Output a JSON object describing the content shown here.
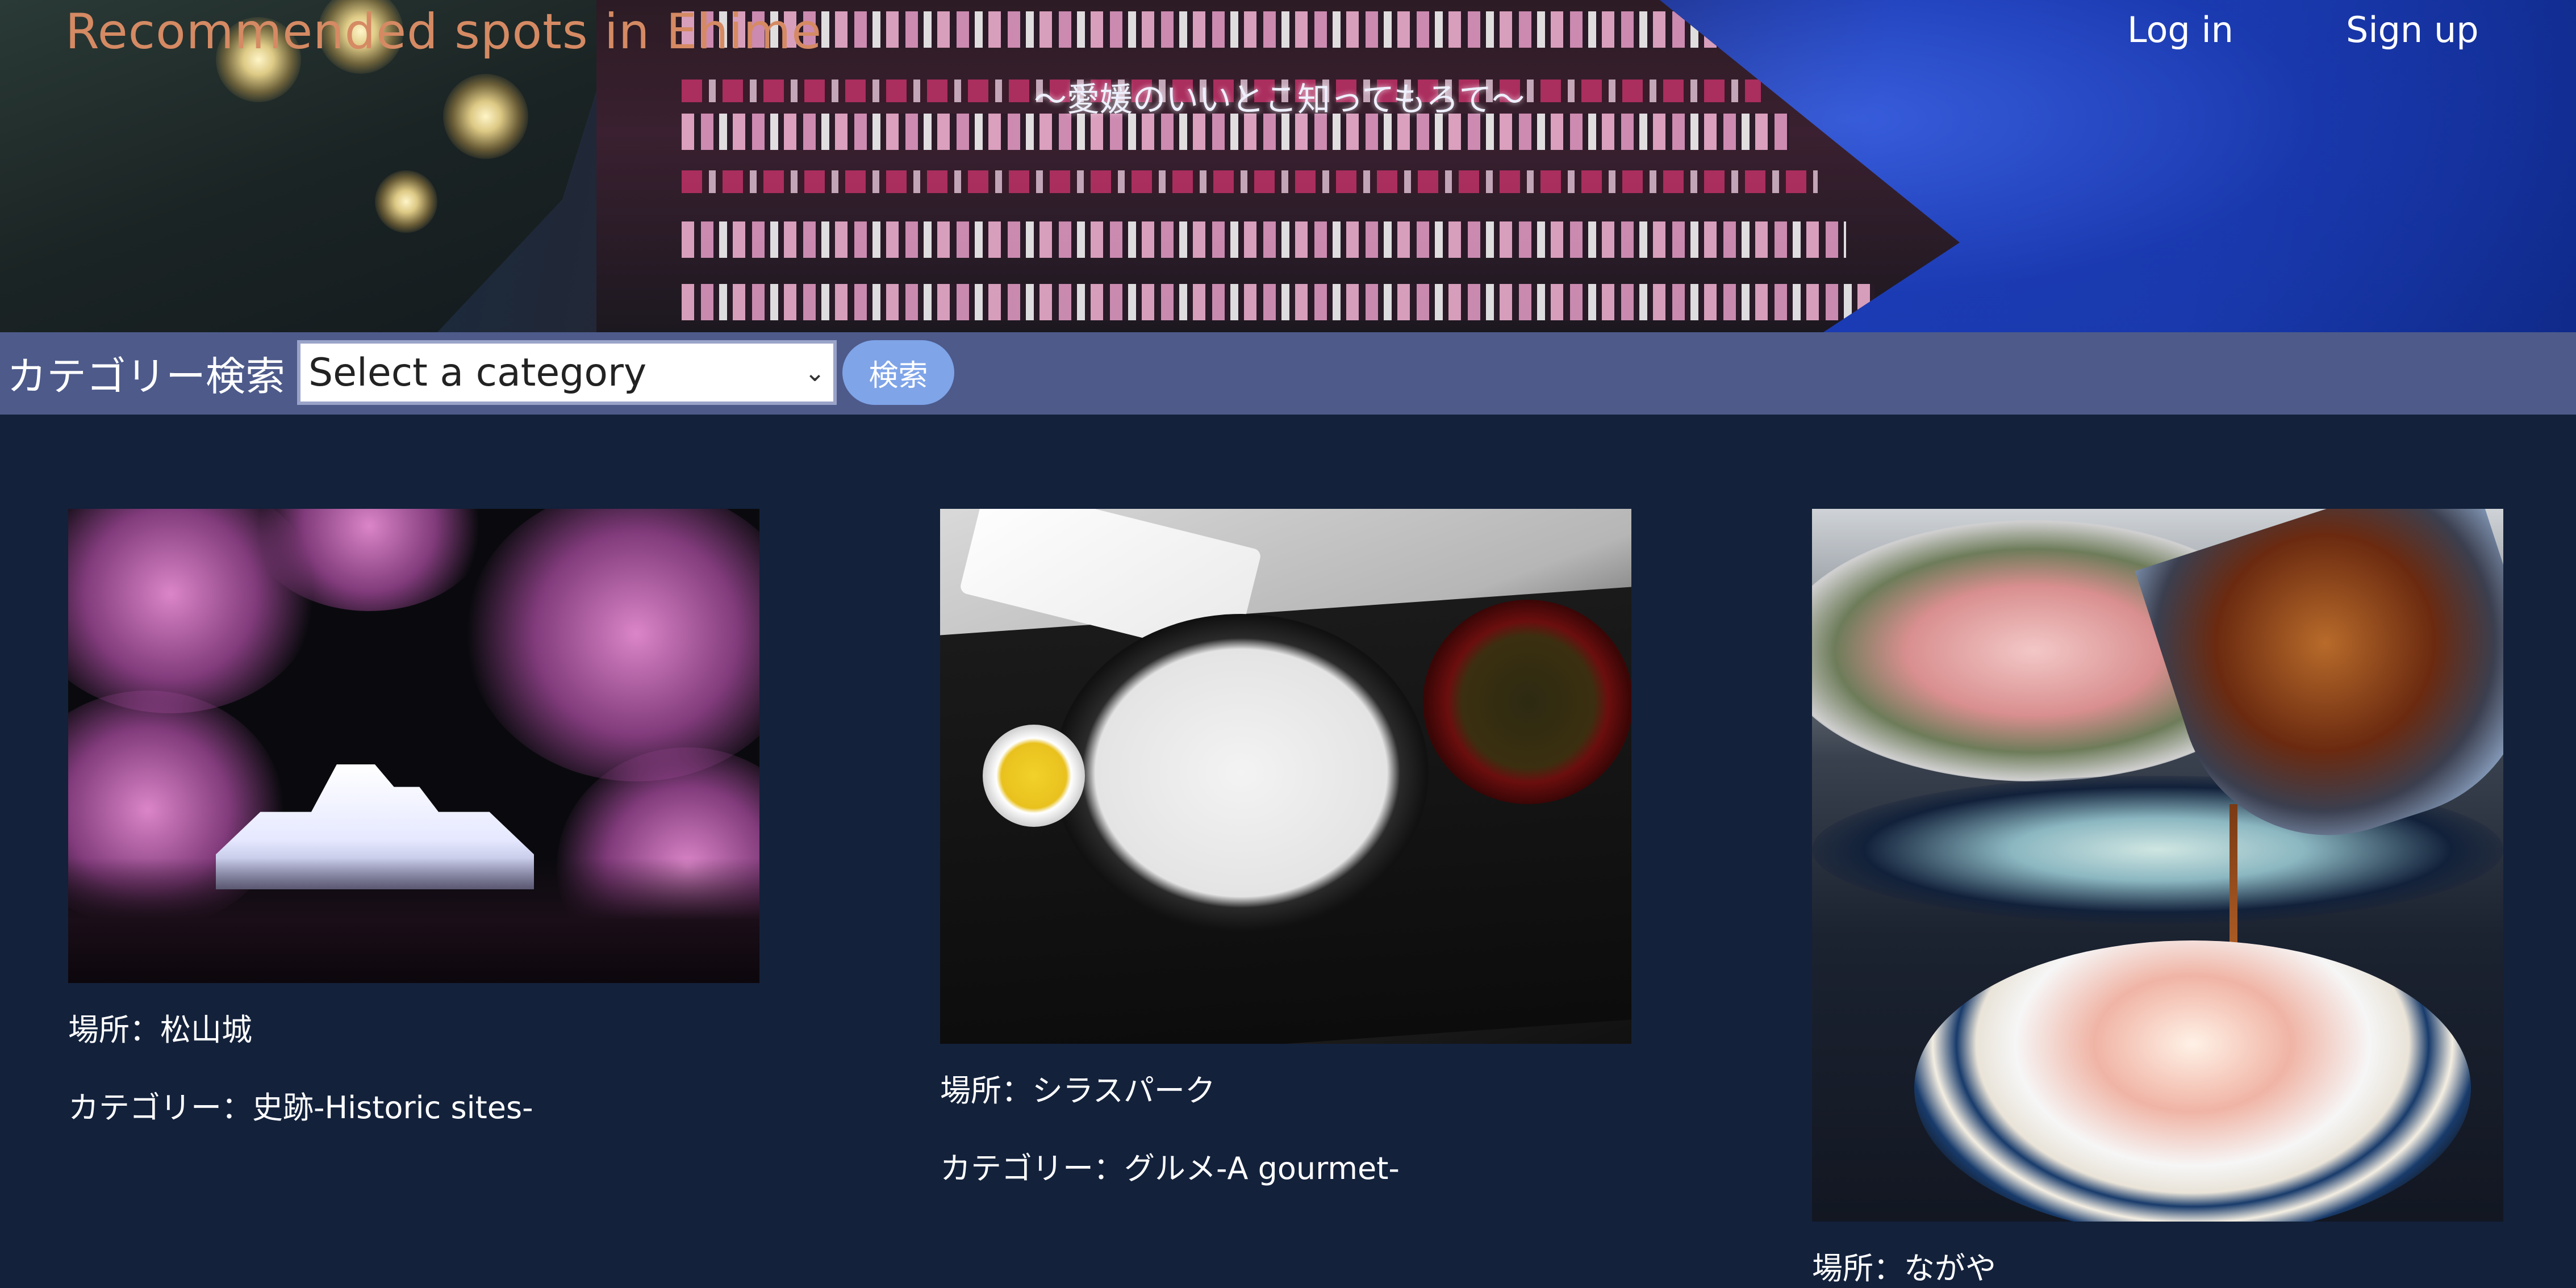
{
  "header": {
    "site_title": "Recommended spots in Ehime",
    "tagline": "〜愛媛のいいとこ知ってもろて〜",
    "nav": {
      "login_label": "Log in",
      "signup_label": "Sign up"
    }
  },
  "search": {
    "label": "カテゴリー検索",
    "select_value": "Select a category",
    "button_label": "検索"
  },
  "cards": [
    {
      "image_alt": "castle-with-cherry-blossoms",
      "location": "場所：松山城",
      "category": "カテゴリー：史跡-Historic sites-"
    },
    {
      "image_alt": "shirasu-rice-bowl",
      "location": "場所：シラスパーク",
      "category": "カテゴリー：グルメ-A gourmet-"
    },
    {
      "image_alt": "tai-meshi-rice-bowl",
      "location": "場所：ながや"
    }
  ],
  "colors": {
    "page_background": "#13213b",
    "search_bar": "#4d5a8a",
    "title_accent": "#d58a63",
    "search_button": "#7fa4e8"
  }
}
